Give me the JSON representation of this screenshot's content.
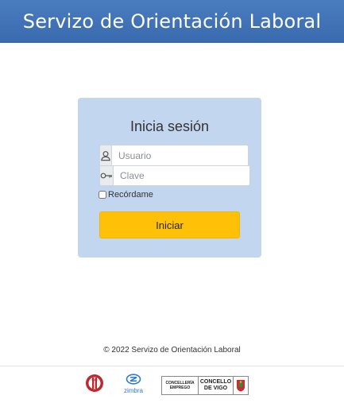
{
  "header": {
    "title": "Servizo de Orientación Laboral",
    "background": "#3f72b8"
  },
  "login": {
    "title": "Inicia sesión",
    "username": {
      "icon": "user-icon",
      "placeholder": "Usuario",
      "value": ""
    },
    "password": {
      "icon": "key-icon",
      "placeholder": "Clave",
      "value": ""
    },
    "remember_label": "Recórdame",
    "remember_checked": false,
    "submit_label": "Iniciar",
    "box_color": "#c2d7ef",
    "button_color": "#ffc107"
  },
  "footer": {
    "copyright": "© 2022 Servizo de Orientación Laboral",
    "logos": {
      "zimbra": "zimbra",
      "concelleria_line1": "CONCELLERÍA",
      "concelleria_line2": "EMPREGO",
      "concello_line1": "CONCELLO",
      "concello_line2": "DE VIGO"
    }
  }
}
